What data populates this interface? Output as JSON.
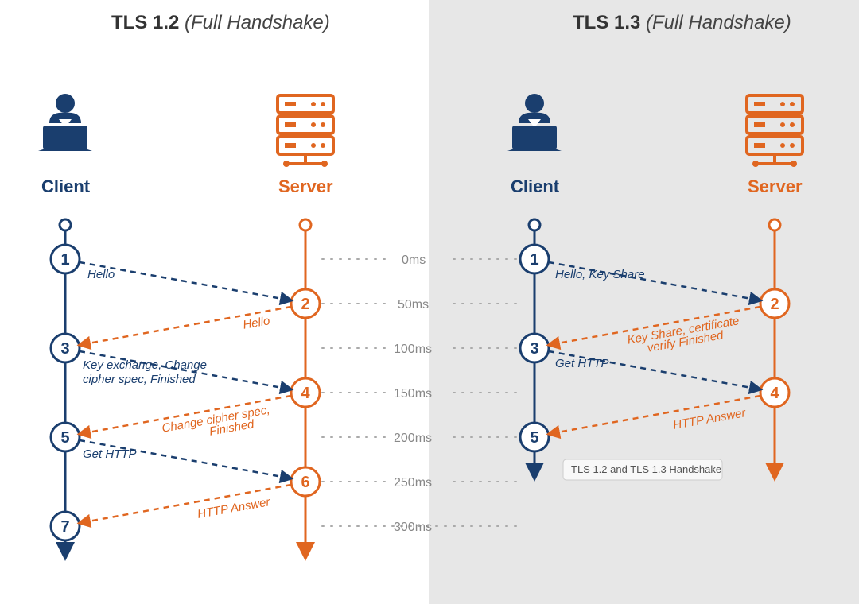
{
  "colors": {
    "client": "#1a3e6e",
    "server": "#e06620",
    "grid": "#bbb",
    "panel": "#e7e7e7"
  },
  "titles": {
    "left_bold": "TLS 1.2",
    "left_ital": "(Full Handshake)",
    "right_bold": "TLS 1.3",
    "right_ital": "(Full Handshake)"
  },
  "roles": {
    "client": "Client",
    "server": "Server"
  },
  "timeline": [
    "0ms",
    "50ms",
    "100ms",
    "150ms",
    "200ms",
    "250ms",
    "300ms"
  ],
  "left": {
    "steps": [
      "1",
      "2",
      "3",
      "4",
      "5",
      "6",
      "7"
    ],
    "messages": {
      "m1": "Hello",
      "m2": "Hello",
      "m3a": "Key exchange, Change",
      "m3b": "cipher spec, Finished",
      "m4a": "Change cipher spec,",
      "m4b": "Finished",
      "m5": "Get HTTP",
      "m6": "HTTP Answer"
    }
  },
  "right": {
    "steps": [
      "1",
      "2",
      "3",
      "4",
      "5"
    ],
    "messages": {
      "m1": "Hello, Key Share",
      "m2a": "Key Share, certificate",
      "m2b": "verify  Finished",
      "m3": "Get HTTP",
      "m4": "HTTP Answer"
    }
  },
  "tooltip": "TLS 1.2 and TLS 1.3 Handshake"
}
